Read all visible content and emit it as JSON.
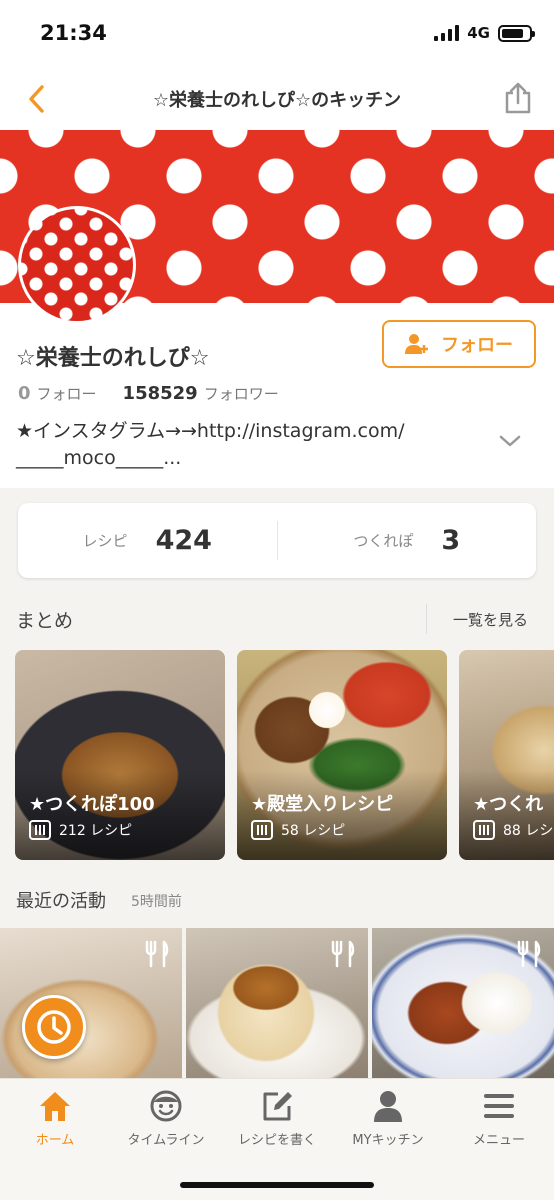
{
  "status": {
    "time": "21:34",
    "network": "4G"
  },
  "nav": {
    "title": "☆栄養士のれしぴ☆のキッチン"
  },
  "profile": {
    "name": "☆栄養士のれしぴ☆",
    "follow_label": "フォロー",
    "following_count": "0",
    "following_label": "フォロー",
    "follower_count": "158529",
    "follower_label": "フォロワー",
    "bio_line1": "★インスタグラム→→http://instagram.com/",
    "bio_line2": "_____moco_____..."
  },
  "stats": [
    {
      "label": "レシピ",
      "value": "424"
    },
    {
      "label": "つくれぽ",
      "value": "3"
    }
  ],
  "collections": {
    "title": "まとめ",
    "see_all": "一覧を見る",
    "items": [
      {
        "title": "★つくれぽ100",
        "count": "212 レシピ"
      },
      {
        "title": "★殿堂入りレシピ",
        "count": "58 レシピ"
      },
      {
        "title": "★つくれ",
        "count": "88 レシ"
      }
    ]
  },
  "activity": {
    "title": "最近の活動",
    "time": "5時間前"
  },
  "tabs": [
    {
      "label": "ホーム",
      "icon": "home-icon",
      "active": true
    },
    {
      "label": "タイムライン",
      "icon": "face-icon",
      "active": false
    },
    {
      "label": "レシピを書く",
      "icon": "edit-icon",
      "active": false
    },
    {
      "label": "MYキッチン",
      "icon": "person-icon",
      "active": false
    },
    {
      "label": "メニュー",
      "icon": "menu-icon",
      "active": false
    }
  ],
  "colors": {
    "accent": "#f39826",
    "banner_red": "#e53323"
  }
}
